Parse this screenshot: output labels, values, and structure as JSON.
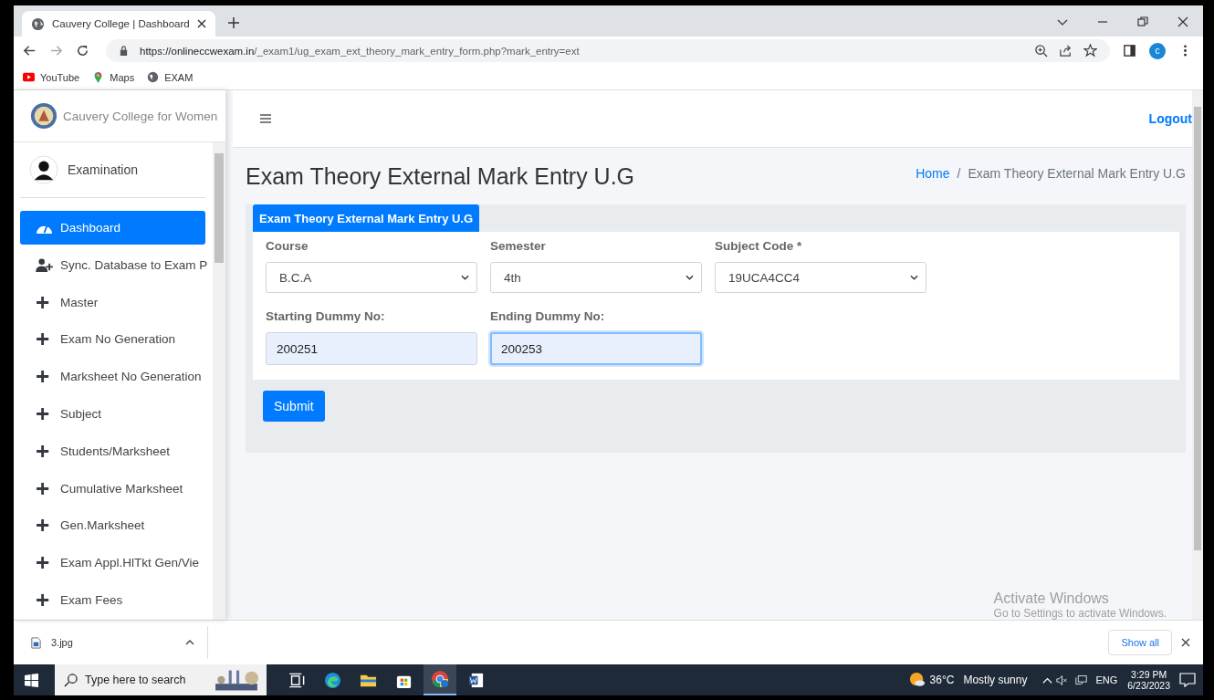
{
  "browser": {
    "tab_title": "Cauvery College | Dashboard",
    "url_host": "https://onlineccwexam.in",
    "url_path": "/_exam1/ug_exam_ext_theory_mark_entry_form.php?mark_entry=ext",
    "profile_initial": "c",
    "bookmarks": [
      {
        "label": "YouTube",
        "kind": "youtube"
      },
      {
        "label": "Maps",
        "kind": "maps"
      },
      {
        "label": "EXAM",
        "kind": "globe"
      }
    ]
  },
  "sidebar": {
    "brand": "Cauvery College for Women",
    "user": "Examination",
    "items": [
      {
        "label": "Dashboard",
        "kind": "dashboard",
        "selected": true
      },
      {
        "label": "Sync. Database to Exam P",
        "kind": "user-plus",
        "selected": false
      },
      {
        "label": "Master",
        "kind": "plus",
        "selected": false
      },
      {
        "label": "Exam No Generation",
        "kind": "plus",
        "selected": false
      },
      {
        "label": "Marksheet No Generation",
        "kind": "plus",
        "selected": false
      },
      {
        "label": "Subject",
        "kind": "plus",
        "selected": false
      },
      {
        "label": "Students/Marksheet",
        "kind": "plus",
        "selected": false
      },
      {
        "label": "Cumulative Marksheet",
        "kind": "plus",
        "selected": false
      },
      {
        "label": "Gen.Marksheet",
        "kind": "plus",
        "selected": false
      },
      {
        "label": "Exam Appl.HlTkt Gen/Vie",
        "kind": "plus",
        "selected": false
      },
      {
        "label": "Exam Fees",
        "kind": "plus",
        "selected": false
      }
    ]
  },
  "header": {
    "logout": "Logout"
  },
  "page": {
    "title": "Exam Theory External Mark Entry U.G",
    "breadcrumb": [
      "Home",
      "Exam Theory External Mark Entry U.G"
    ],
    "breadcrumb_separator": "/"
  },
  "form": {
    "tab": "Exam Theory External Mark Entry U.G",
    "fields": [
      {
        "label": "Course",
        "value": "B.C.A",
        "kind": "select"
      },
      {
        "label": "Semester",
        "value": "4th",
        "kind": "select"
      },
      {
        "label": "Subject Code *",
        "value": "19UCA4CC4",
        "kind": "select"
      },
      {
        "label": "Starting Dummy No:",
        "value": "200251",
        "kind": "text",
        "focused": false
      },
      {
        "label": "Ending Dummy No:",
        "value": "200253",
        "kind": "text",
        "focused": true
      }
    ],
    "submit": "Submit"
  },
  "activation": {
    "title": "Activate Windows",
    "subtitle": "Go to Settings to activate Windows."
  },
  "downloads": {
    "file": "3.jpg",
    "show_all": "Show all"
  },
  "taskbar": {
    "search_placeholder": "Type here to search",
    "temperature": "36°C",
    "weather": "Mostly sunny",
    "language": "ENG",
    "time": "3:29 PM",
    "date": "6/23/2023"
  }
}
